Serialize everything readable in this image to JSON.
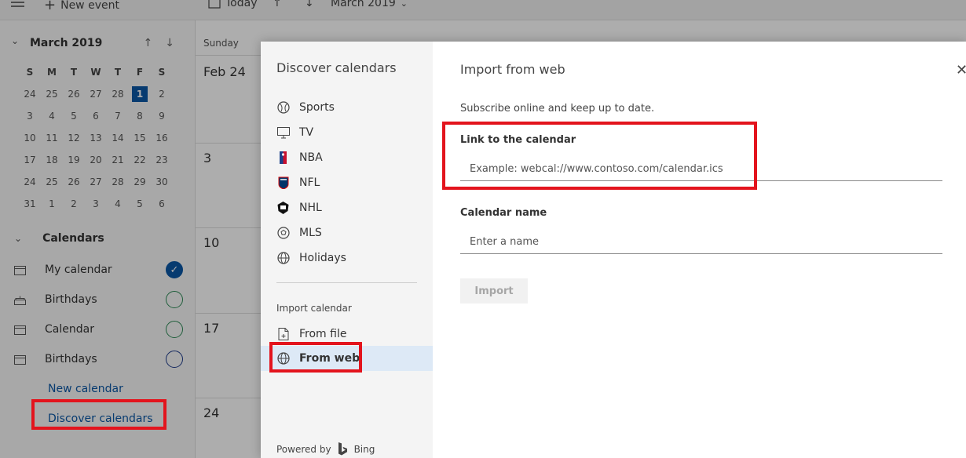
{
  "topbar": {
    "new_event": "New event",
    "today": "Today",
    "month": "March 2019"
  },
  "mini_calendar": {
    "month": "March 2019",
    "day_headers": [
      "S",
      "M",
      "T",
      "W",
      "T",
      "F",
      "S"
    ],
    "weeks": [
      [
        "24",
        "25",
        "26",
        "27",
        "28",
        "1",
        "2"
      ],
      [
        "3",
        "4",
        "5",
        "6",
        "7",
        "8",
        "9"
      ],
      [
        "10",
        "11",
        "12",
        "13",
        "14",
        "15",
        "16"
      ],
      [
        "17",
        "18",
        "19",
        "20",
        "21",
        "22",
        "23"
      ],
      [
        "24",
        "25",
        "26",
        "27",
        "28",
        "29",
        "30"
      ],
      [
        "31",
        "1",
        "2",
        "3",
        "4",
        "5",
        "6"
      ]
    ],
    "today": "1"
  },
  "calendars": {
    "heading": "Calendars",
    "items": [
      {
        "label": "My calendar",
        "state": "checked"
      },
      {
        "label": "Birthdays",
        "state": "green"
      },
      {
        "label": "Calendar",
        "state": "green"
      },
      {
        "label": "Birthdays",
        "state": "blue"
      }
    ],
    "new_calendar": "New calendar",
    "discover_calendars": "Discover calendars"
  },
  "main_calendar": {
    "day_header": "Sunday",
    "dates": [
      "Feb 24",
      "3",
      "10",
      "17",
      "24"
    ]
  },
  "dialog": {
    "nav_title": "Discover calendars",
    "categories": [
      "Sports",
      "TV",
      "NBA",
      "NFL",
      "NHL",
      "MLS",
      "Holidays"
    ],
    "import_heading": "Import calendar",
    "from_file": "From file",
    "from_web": "From web",
    "powered_by": "Powered by",
    "bing": "Bing",
    "content_title": "Import from web",
    "description": "Subscribe online and keep up to date.",
    "link_label": "Link to the calendar",
    "link_placeholder": "Example: webcal://www.contoso.com/calendar.ics",
    "name_label": "Calendar name",
    "name_placeholder": "Enter a name",
    "import_button": "Import"
  },
  "colors": {
    "accent": "#0b57a6",
    "highlight": "#e3141d",
    "selected_nav": "#dde9f6"
  }
}
